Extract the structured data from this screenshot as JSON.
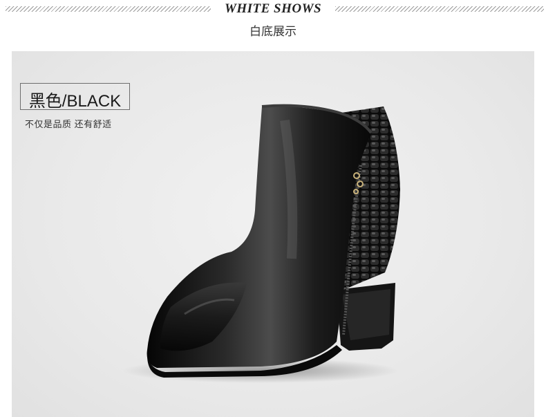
{
  "header": {
    "title": "WHITE SHOWS",
    "subtitle": "白底展示"
  },
  "product": {
    "color_label": "黑色/BLACK",
    "tagline": "不仅是品质 还有舒适",
    "boot_color": "#111111"
  }
}
